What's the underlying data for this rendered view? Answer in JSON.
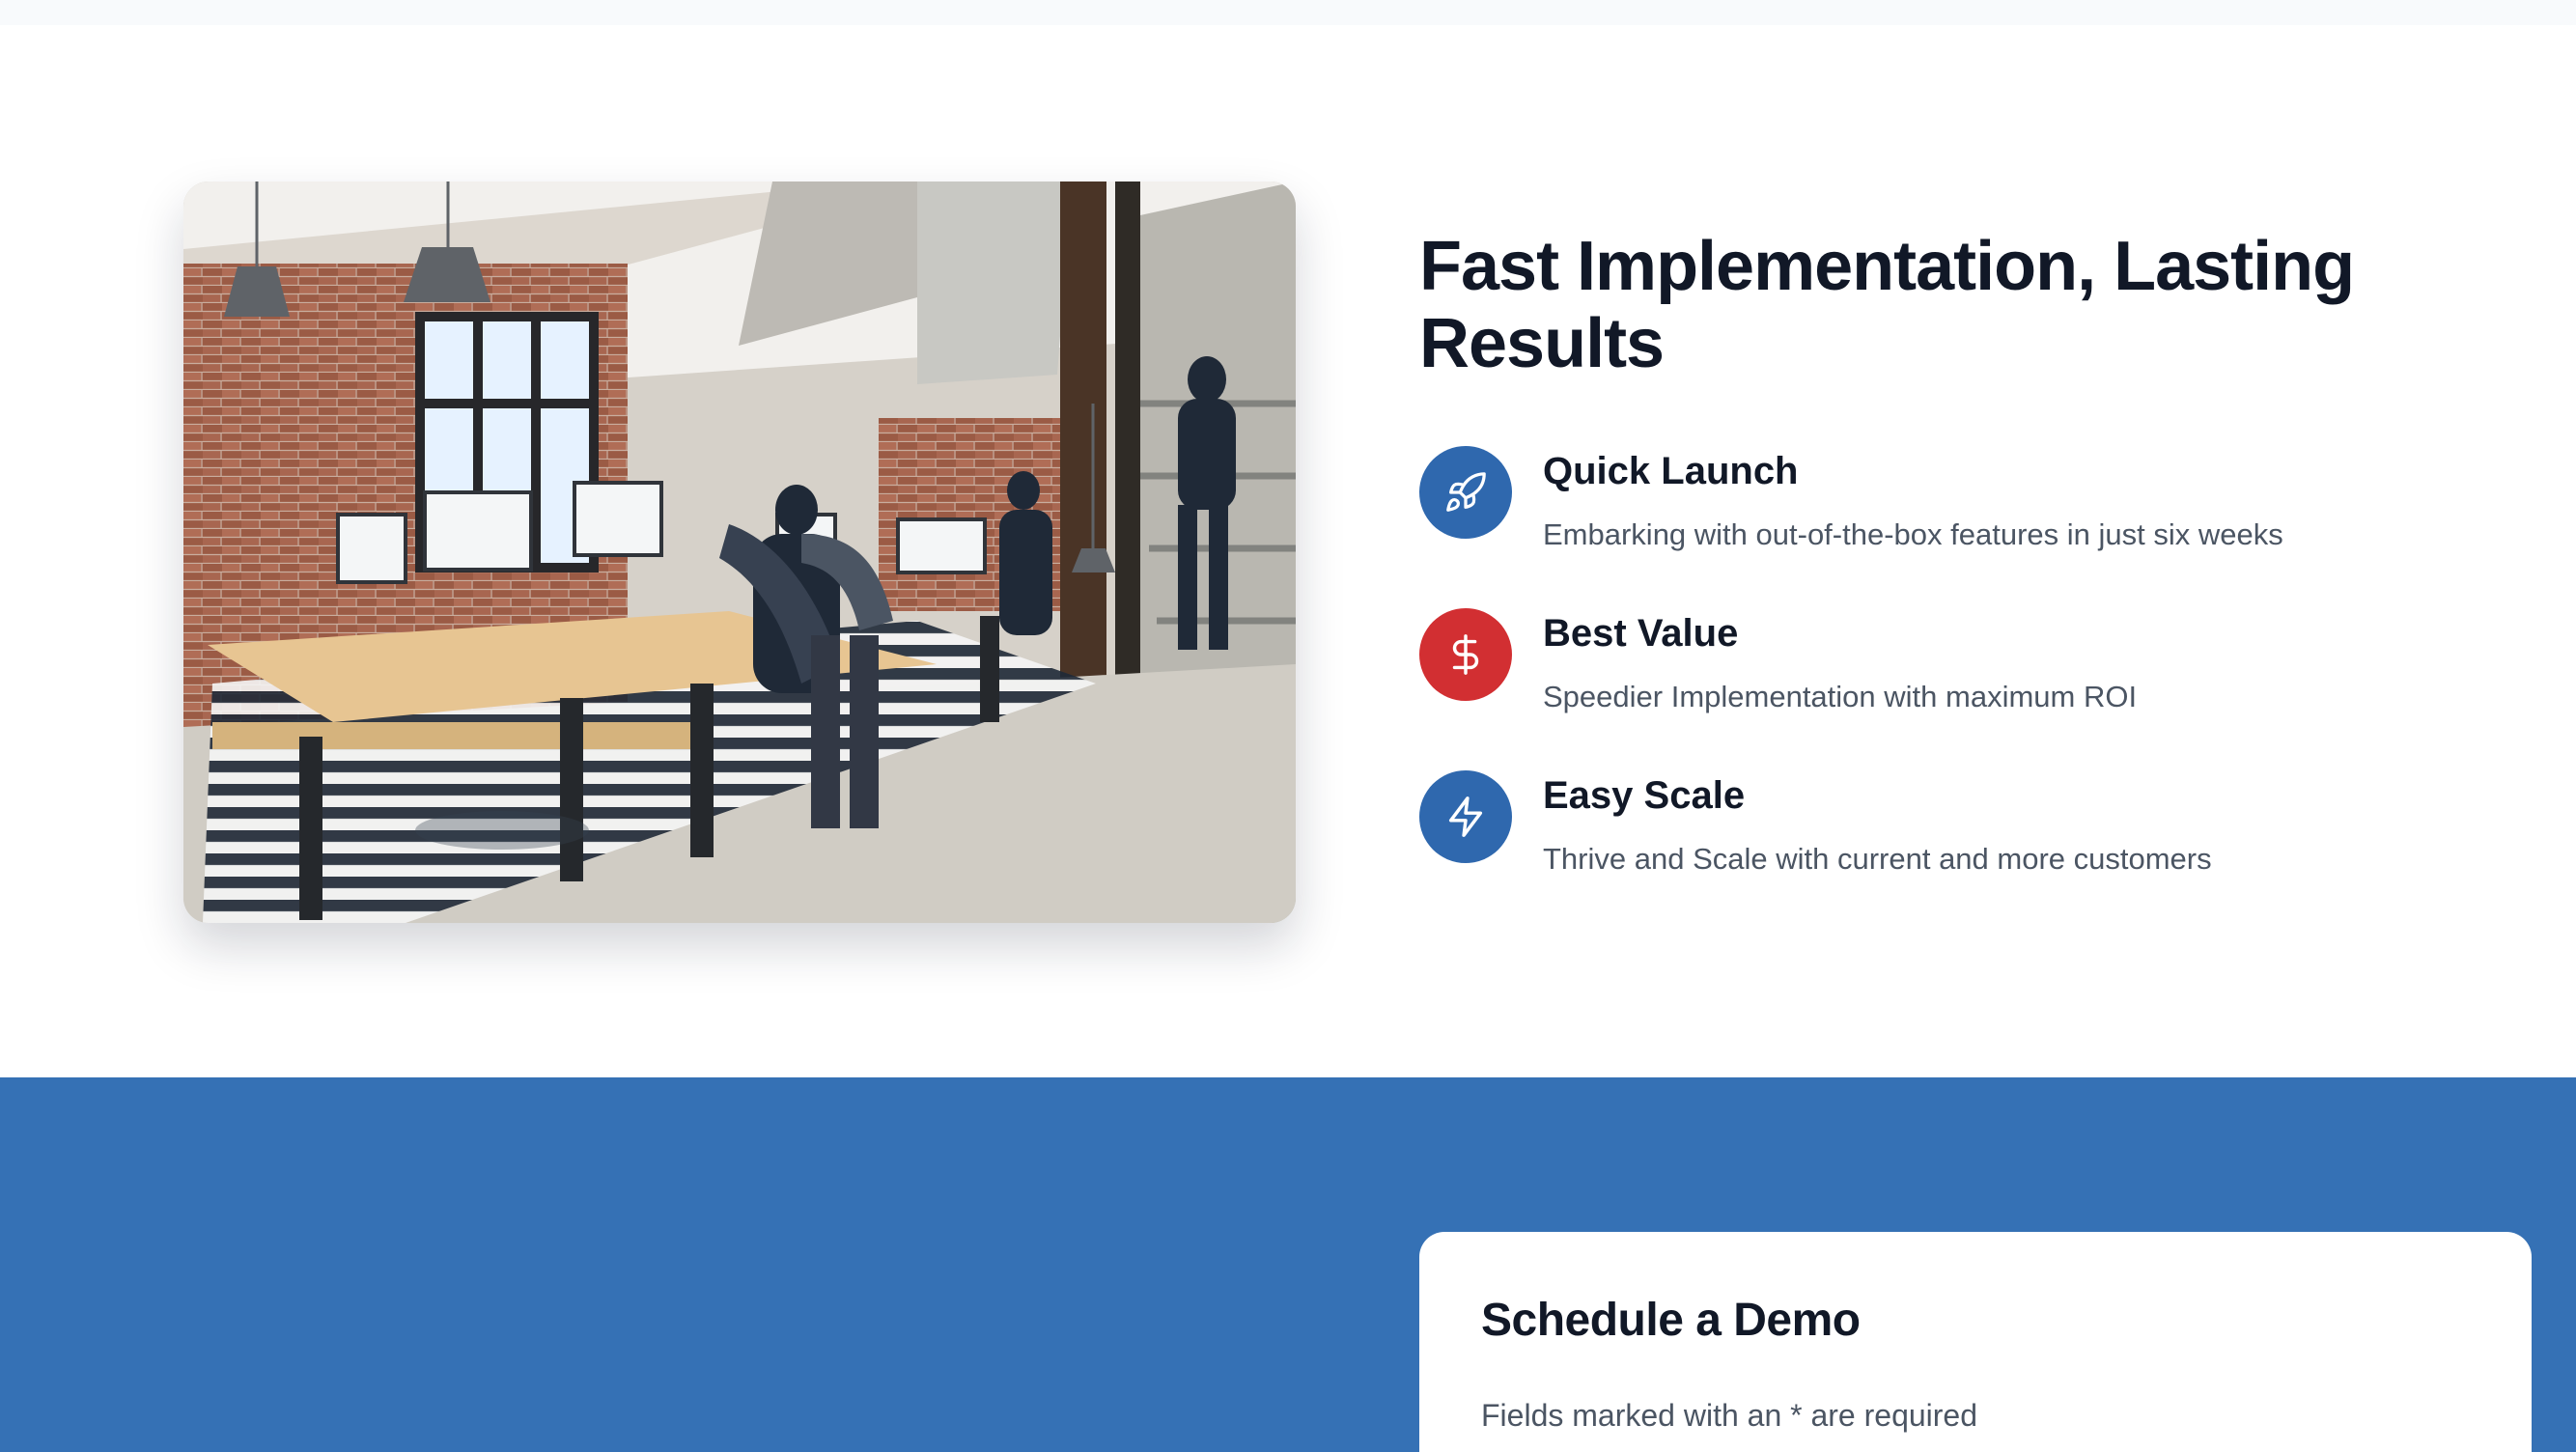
{
  "feature_section": {
    "headline": "Fast Implementation, Lasting Results",
    "items": [
      {
        "title": "Quick Launch",
        "description": "Embarking with out-of-the-box features in just six weeks",
        "icon": "rocket-icon",
        "color": "#2f68ae"
      },
      {
        "title": "Best Value",
        "description": "Speedier Implementation with maximum ROI",
        "icon": "dollar-icon",
        "color": "#d22f32"
      },
      {
        "title": "Easy Scale",
        "description": "Thrive and Scale with current and more customers",
        "icon": "lightning-icon",
        "color": "#2f68ae"
      }
    ]
  },
  "demo_section": {
    "title": "Schedule a Demo",
    "note": "Fields marked with an * are required",
    "background": "#3571b5"
  }
}
